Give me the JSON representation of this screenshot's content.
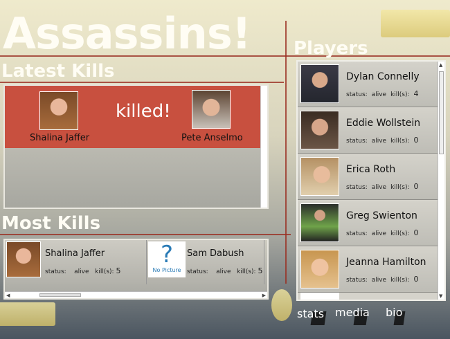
{
  "app": {
    "title": "Assassins!"
  },
  "sections": {
    "latest": "Latest Kills",
    "most": "Most Kills",
    "players": "Players"
  },
  "latest_kill": {
    "killer": "Shalina Jaffer",
    "verb": "killed!",
    "victim": "Pete Anselmo"
  },
  "most_kills": [
    {
      "name": "Shalina Jaffer",
      "status_label": "status:",
      "status": "alive",
      "kills_label": "kill(s):",
      "kills": "5",
      "photo": "photo"
    },
    {
      "name": "Sam Dabush",
      "status_label": "status:",
      "status": "alive",
      "kills_label": "kill(s):",
      "kills": "5",
      "photo": "no-picture",
      "placeholder_mark": "?",
      "placeholder_text": "No Picture"
    }
  ],
  "players": [
    {
      "name": "Dylan Connelly",
      "status_label": "status:",
      "status": "alive",
      "kills_label": "kill(s):",
      "kills": "4"
    },
    {
      "name": "Eddie Wollstein",
      "status_label": "status:",
      "status": "alive",
      "kills_label": "kill(s):",
      "kills": "0"
    },
    {
      "name": "Erica Roth",
      "status_label": "status:",
      "status": "alive",
      "kills_label": "kill(s):",
      "kills": "0"
    },
    {
      "name": "Greg Swienton",
      "status_label": "status:",
      "status": "alive",
      "kills_label": "kill(s):",
      "kills": "0"
    },
    {
      "name": "Jeanna Hamilton",
      "status_label": "status:",
      "status": "alive",
      "kills_label": "kill(s):",
      "kills": "0"
    }
  ],
  "nav": {
    "stats": "stats",
    "media": "media",
    "bio": "bio"
  },
  "colors": {
    "kill_row": "#c8503f",
    "accent_stroke": "#9a2e22",
    "no_picture_blue": "#2a7bb6"
  }
}
